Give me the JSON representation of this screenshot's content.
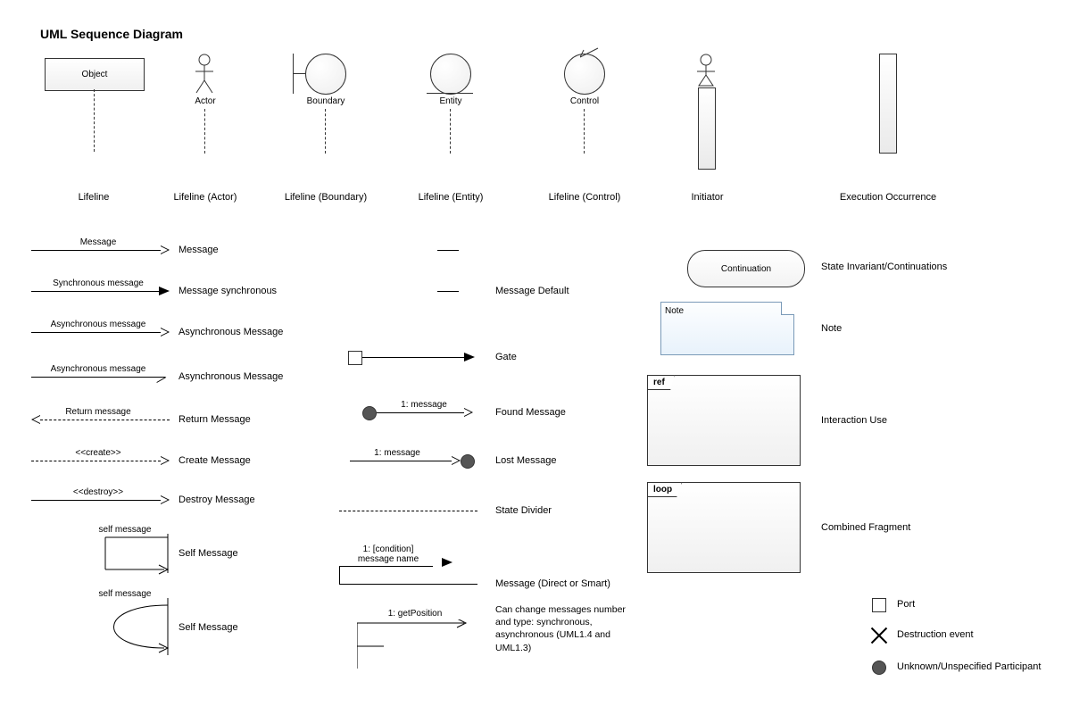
{
  "title": "UML Sequence Diagram",
  "row1": {
    "object": "Object",
    "labels": {
      "lifeline": "Lifeline",
      "actor": "Actor",
      "actor_label": "Lifeline (Actor)",
      "boundary": "Boundary",
      "boundary_label": "Lifeline (Boundary)",
      "entity": "Entity",
      "entity_label": "Lifeline (Entity)",
      "control": "Control",
      "control_label": "Lifeline (Control)",
      "initiator": "Initiator",
      "exec": "Execution Occurrence"
    }
  },
  "col1": {
    "m1_top": "Message",
    "m1_right": "Message",
    "m2_top": "Synchronous message",
    "m2_right": "Message synchronous",
    "m3_top": "Asynchronous message",
    "m3_right": "Asynchronous Message",
    "m4_top": "Asynchronous message",
    "m4_right": "Asynchronous Message",
    "m5_top": "Return message",
    "m5_right": "Return Message",
    "m6_top": "<<create>>",
    "m6_right": "Create Message",
    "m7_top": "<<destroy>>",
    "m7_right": "Destroy Message",
    "m8_top": "self message",
    "m8_right": "Self Message",
    "m9_top": "self message",
    "m9_right": "Self Message"
  },
  "col2": {
    "default": "Message Default",
    "gate": "Gate",
    "found_top": "1: message",
    "found": "Found Message",
    "lost_top": "1: message",
    "lost": "Lost Message",
    "divider": "State Divider",
    "direct_top1": "1: [condition]",
    "direct_top2": "message name",
    "direct": "Message (Direct or Smart)",
    "getpos": "1: getPosition",
    "note": "Can change messages number and type: synchronous, asynchronous (UML1.4 and UML1.3)"
  },
  "col3": {
    "continuation": "Continuation",
    "continuation_label": "State Invariant/Continuations",
    "note_inner": "Note",
    "note_label": "Note",
    "ref": "ref",
    "ref_label": "Interaction Use",
    "loop": "loop",
    "loop_label": "Combined Fragment",
    "port": "Port",
    "destruction": "Destruction event",
    "unknown": "Unknown/Unspecified Participant"
  }
}
